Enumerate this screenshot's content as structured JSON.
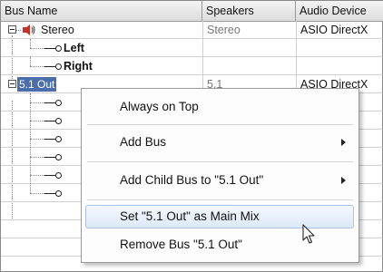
{
  "columns": [
    "Bus Name",
    "Speakers",
    "Audio Device"
  ],
  "rows": [
    {
      "name": "Stereo",
      "speakers": "Stereo",
      "device": "ASIO DirectX"
    },
    {
      "name": "Left",
      "speakers": "",
      "device": ""
    },
    {
      "name": "Right",
      "speakers": "",
      "device": ""
    },
    {
      "name": "5.1 Out",
      "speakers": "5.1",
      "device": "ASIO DirectX"
    }
  ],
  "context_menu": {
    "items": [
      {
        "label": "Always on Top",
        "submenu": false
      },
      {
        "label": "Add Bus",
        "submenu": true
      },
      {
        "label": "Add Child Bus to \"5.1 Out\"",
        "submenu": true
      },
      {
        "label": "Set \"5.1 Out\" as Main Mix",
        "submenu": false,
        "highlighted": true
      },
      {
        "label": "Remove Bus \"5.1 Out\"",
        "submenu": false
      }
    ]
  },
  "icons": {
    "speaker": "speaker-icon",
    "channel": "channel-connector-icon",
    "expander": "tree-expander-icon",
    "cursor": "mouse-pointer-icon"
  },
  "colors": {
    "selection": "#4a6ea9",
    "menu_highlight": "#dde9f8",
    "speaker_red": "#c8322a"
  }
}
